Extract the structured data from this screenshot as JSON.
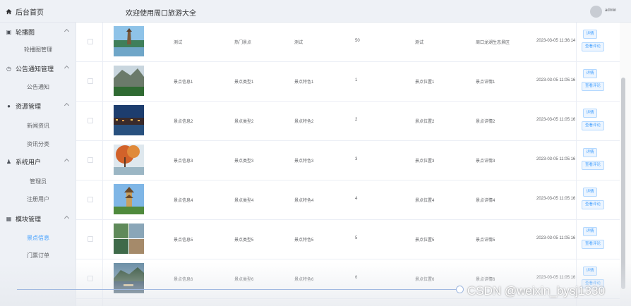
{
  "header": {
    "home_label": "后台首页",
    "welcome": "欢迎使用周口旅游大全",
    "username": "admin"
  },
  "sidebar": {
    "groups": [
      {
        "label": "轮播图",
        "icon": "image-icon",
        "items": [
          "轮播图管理"
        ]
      },
      {
        "label": "公告通知管理",
        "icon": "clock-icon",
        "items": [
          "公告通知"
        ]
      },
      {
        "label": "资源管理",
        "icon": "pin-icon",
        "items": [
          "新闻资讯",
          "资讯分类"
        ]
      },
      {
        "label": "系统用户",
        "icon": "user-icon",
        "items": [
          "管理员",
          "注册用户"
        ]
      },
      {
        "label": "模块管理",
        "icon": "grid-icon",
        "items": [
          "景点信息",
          "门票订单"
        ]
      }
    ],
    "active_item": "景点信息"
  },
  "table": {
    "rows": [
      {
        "name": "测试",
        "type": "热门景点",
        "feature": "测试",
        "count": "50",
        "location": "测试",
        "detail": "周口龙湖生态景区",
        "time": "2023-03-05 11:36:14",
        "thumb": "lake-pagoda"
      },
      {
        "name": "景点信息1",
        "type": "景点类型1",
        "feature": "景点特色1",
        "count": "1",
        "location": "景点位置1",
        "detail": "景点详情1",
        "time": "2023-03-05 11:05:16",
        "thumb": "mountain-cliff"
      },
      {
        "name": "景点信息2",
        "type": "景点类型2",
        "feature": "景点特色2",
        "count": "2",
        "location": "景点位置2",
        "detail": "景点详情2",
        "time": "2023-03-05 11:05:16",
        "thumb": "night-town"
      },
      {
        "name": "景点信息3",
        "type": "景点类型3",
        "feature": "景点特色3",
        "count": "3",
        "location": "景点位置3",
        "detail": "景点详情3",
        "time": "2023-03-05 11:05:16",
        "thumb": "autumn-tree"
      },
      {
        "name": "景点信息4",
        "type": "景点类型4",
        "feature": "景点特色4",
        "count": "4",
        "location": "景点位置4",
        "detail": "景点详情4",
        "time": "2023-03-05 11:05:16",
        "thumb": "pagoda-tower"
      },
      {
        "name": "景点信息5",
        "type": "景点类型5",
        "feature": "景点特色5",
        "count": "5",
        "location": "景点位置5",
        "detail": "景点详情5",
        "time": "2023-03-05 11:05:16",
        "thumb": "scenic-collage"
      },
      {
        "name": "景点信息6",
        "type": "景点类型6",
        "feature": "景点特色6",
        "count": "6",
        "location": "景点位置6",
        "detail": "景点详情6",
        "time": "2023-03-05 11:05:16",
        "thumb": "river-boat"
      }
    ],
    "detail_button": "详情",
    "review_button": "查看评论"
  },
  "watermark": "CSDN @weixin_bysj1330",
  "colors": {
    "accent": "#409eff",
    "sidebar_bg": "#eef1f6",
    "border": "#ebeef5"
  }
}
